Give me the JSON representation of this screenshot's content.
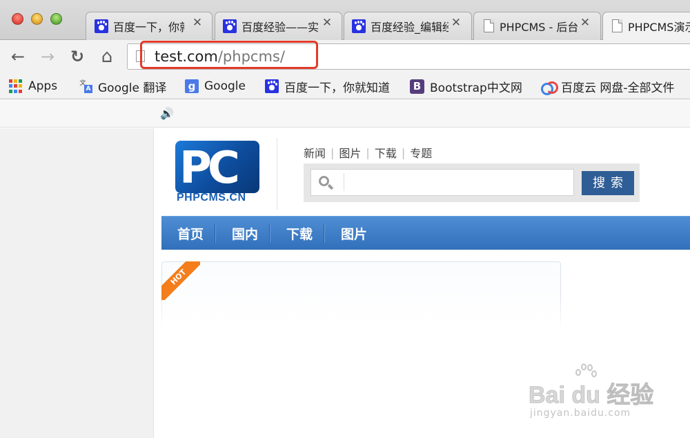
{
  "browser": {
    "tabs": [
      {
        "title": "百度一下，你就知道",
        "favicon": "baidu-paw-icon"
      },
      {
        "title": "百度经验——实用生活指南",
        "favicon": "baidu-paw-icon"
      },
      {
        "title": "百度经验_编辑经验",
        "favicon": "baidu-paw-icon"
      },
      {
        "title": "PHPCMS - 后台管理中心",
        "favicon": "document-icon"
      },
      {
        "title": "PHPCMS演示站",
        "favicon": "document-icon"
      }
    ],
    "close_glyph": "✕",
    "nav": {
      "back": "←",
      "forward": "→",
      "reload": "↻",
      "home": "⌂"
    },
    "url_host": "test.com",
    "url_path": "/phpcms/",
    "bookmarks": [
      {
        "label": "Apps",
        "icon": "apps-grid-icon"
      },
      {
        "label": "Google 翻译",
        "icon": "google-translate-icon"
      },
      {
        "label": "Google",
        "icon": "google-icon"
      },
      {
        "label": "百度一下，你就知道",
        "icon": "baidu-paw-icon"
      },
      {
        "label": "Bootstrap中文网",
        "icon": "bootstrap-icon"
      },
      {
        "label": "百度云 网盘-全部文件",
        "icon": "baidu-cloud-icon"
      }
    ],
    "highlight_color": "#e23a2a"
  },
  "site": {
    "speaker_icon": "🔊",
    "logo_letters": "PC",
    "logo_text": "PHPCMS.CN",
    "search_tabs": [
      "新闻",
      "图片",
      "下载",
      "专题"
    ],
    "search_placeholder": "",
    "search_button": "搜索",
    "main_nav": [
      "首页",
      "国内",
      "下载",
      "图片"
    ],
    "hot_badge": "HOT",
    "accent": "#3170bb",
    "hot_color": "#f47d1c"
  },
  "watermark": {
    "brand": "Bai du 经验",
    "url": "jingyan.baidu.com"
  }
}
